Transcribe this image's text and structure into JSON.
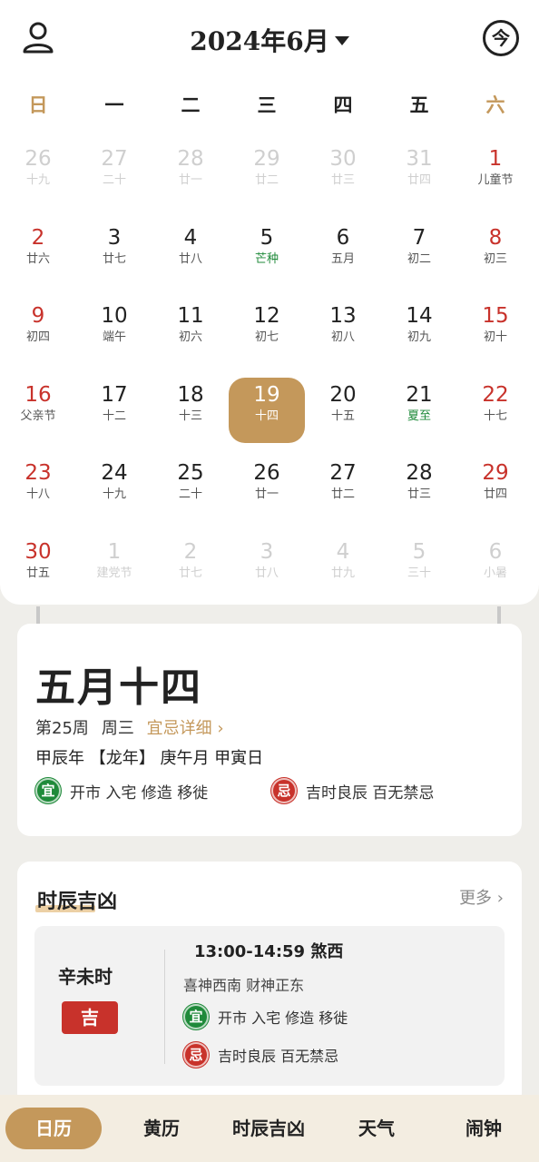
{
  "header": {
    "title": "2024年6月",
    "today_label": "今"
  },
  "weekdays": [
    "日",
    "一",
    "二",
    "三",
    "四",
    "五",
    "六"
  ],
  "colors": {
    "accent": "#c4985b",
    "weekend": "#c8322b",
    "festival_green": "#1f8a3a",
    "faded": "#c8c8c8"
  },
  "calendar": [
    [
      {
        "d": "26",
        "l": "十九",
        "t": "faded"
      },
      {
        "d": "27",
        "l": "二十",
        "t": "faded"
      },
      {
        "d": "28",
        "l": "廿一",
        "t": "faded"
      },
      {
        "d": "29",
        "l": "廿二",
        "t": "faded"
      },
      {
        "d": "30",
        "l": "廿三",
        "t": "faded"
      },
      {
        "d": "31",
        "l": "廿四",
        "t": "faded"
      },
      {
        "d": "1",
        "l": "儿童节",
        "t": "weekend"
      }
    ],
    [
      {
        "d": "2",
        "l": "廿六",
        "t": "weekend"
      },
      {
        "d": "3",
        "l": "廿七",
        "t": "normal"
      },
      {
        "d": "4",
        "l": "廿八",
        "t": "normal"
      },
      {
        "d": "5",
        "l": "芒种",
        "t": "term"
      },
      {
        "d": "6",
        "l": "五月",
        "t": "normal"
      },
      {
        "d": "7",
        "l": "初二",
        "t": "normal"
      },
      {
        "d": "8",
        "l": "初三",
        "t": "weekend"
      }
    ],
    [
      {
        "d": "9",
        "l": "初四",
        "t": "weekend"
      },
      {
        "d": "10",
        "l": "端午",
        "t": "normal"
      },
      {
        "d": "11",
        "l": "初六",
        "t": "normal"
      },
      {
        "d": "12",
        "l": "初七",
        "t": "normal"
      },
      {
        "d": "13",
        "l": "初八",
        "t": "normal"
      },
      {
        "d": "14",
        "l": "初九",
        "t": "normal"
      },
      {
        "d": "15",
        "l": "初十",
        "t": "weekend"
      }
    ],
    [
      {
        "d": "16",
        "l": "父亲节",
        "t": "weekend"
      },
      {
        "d": "17",
        "l": "十二",
        "t": "normal"
      },
      {
        "d": "18",
        "l": "十三",
        "t": "normal"
      },
      {
        "d": "19",
        "l": "十四",
        "t": "today"
      },
      {
        "d": "20",
        "l": "十五",
        "t": "normal"
      },
      {
        "d": "21",
        "l": "夏至",
        "t": "term"
      },
      {
        "d": "22",
        "l": "十七",
        "t": "weekend"
      }
    ],
    [
      {
        "d": "23",
        "l": "十八",
        "t": "weekend"
      },
      {
        "d": "24",
        "l": "十九",
        "t": "normal"
      },
      {
        "d": "25",
        "l": "二十",
        "t": "normal"
      },
      {
        "d": "26",
        "l": "廿一",
        "t": "normal"
      },
      {
        "d": "27",
        "l": "廿二",
        "t": "normal"
      },
      {
        "d": "28",
        "l": "廿三",
        "t": "normal"
      },
      {
        "d": "29",
        "l": "廿四",
        "t": "weekend"
      }
    ],
    [
      {
        "d": "30",
        "l": "廿五",
        "t": "weekend"
      },
      {
        "d": "1",
        "l": "建党节",
        "t": "faded"
      },
      {
        "d": "2",
        "l": "廿七",
        "t": "faded"
      },
      {
        "d": "3",
        "l": "廿八",
        "t": "faded"
      },
      {
        "d": "4",
        "l": "廿九",
        "t": "faded"
      },
      {
        "d": "5",
        "l": "三十",
        "t": "faded"
      },
      {
        "d": "6",
        "l": "小暑",
        "t": "faded"
      }
    ]
  ],
  "day_card": {
    "lunar_date": "五月十四",
    "week_no": "第25周",
    "weekday": "周三",
    "yiji_link": "宜忌详细",
    "ganzhi": "甲辰年 【龙年】 庚午月 甲寅日",
    "yi_badge": "宜",
    "yi_text": "开市 入宅 修造 移徙",
    "ji_badge": "忌",
    "ji_text": "吉时良辰 百无禁忌"
  },
  "hour_card": {
    "title": "时辰吉凶",
    "more": "更多",
    "shichen": "辛未时",
    "luck": "吉",
    "time": "13:00-14:59 煞西",
    "shen": "喜神西南 财神正东",
    "yi_badge": "宜",
    "yi_text": "开市 入宅 修造 移徙",
    "ji_badge": "忌",
    "ji_text": "吉时良辰 百无禁忌"
  },
  "tabs": [
    {
      "label": "日历",
      "active": true
    },
    {
      "label": "黄历",
      "active": false
    },
    {
      "label": "时辰吉凶",
      "active": false
    },
    {
      "label": "天气",
      "active": false
    },
    {
      "label": "闹钟",
      "active": false
    }
  ]
}
